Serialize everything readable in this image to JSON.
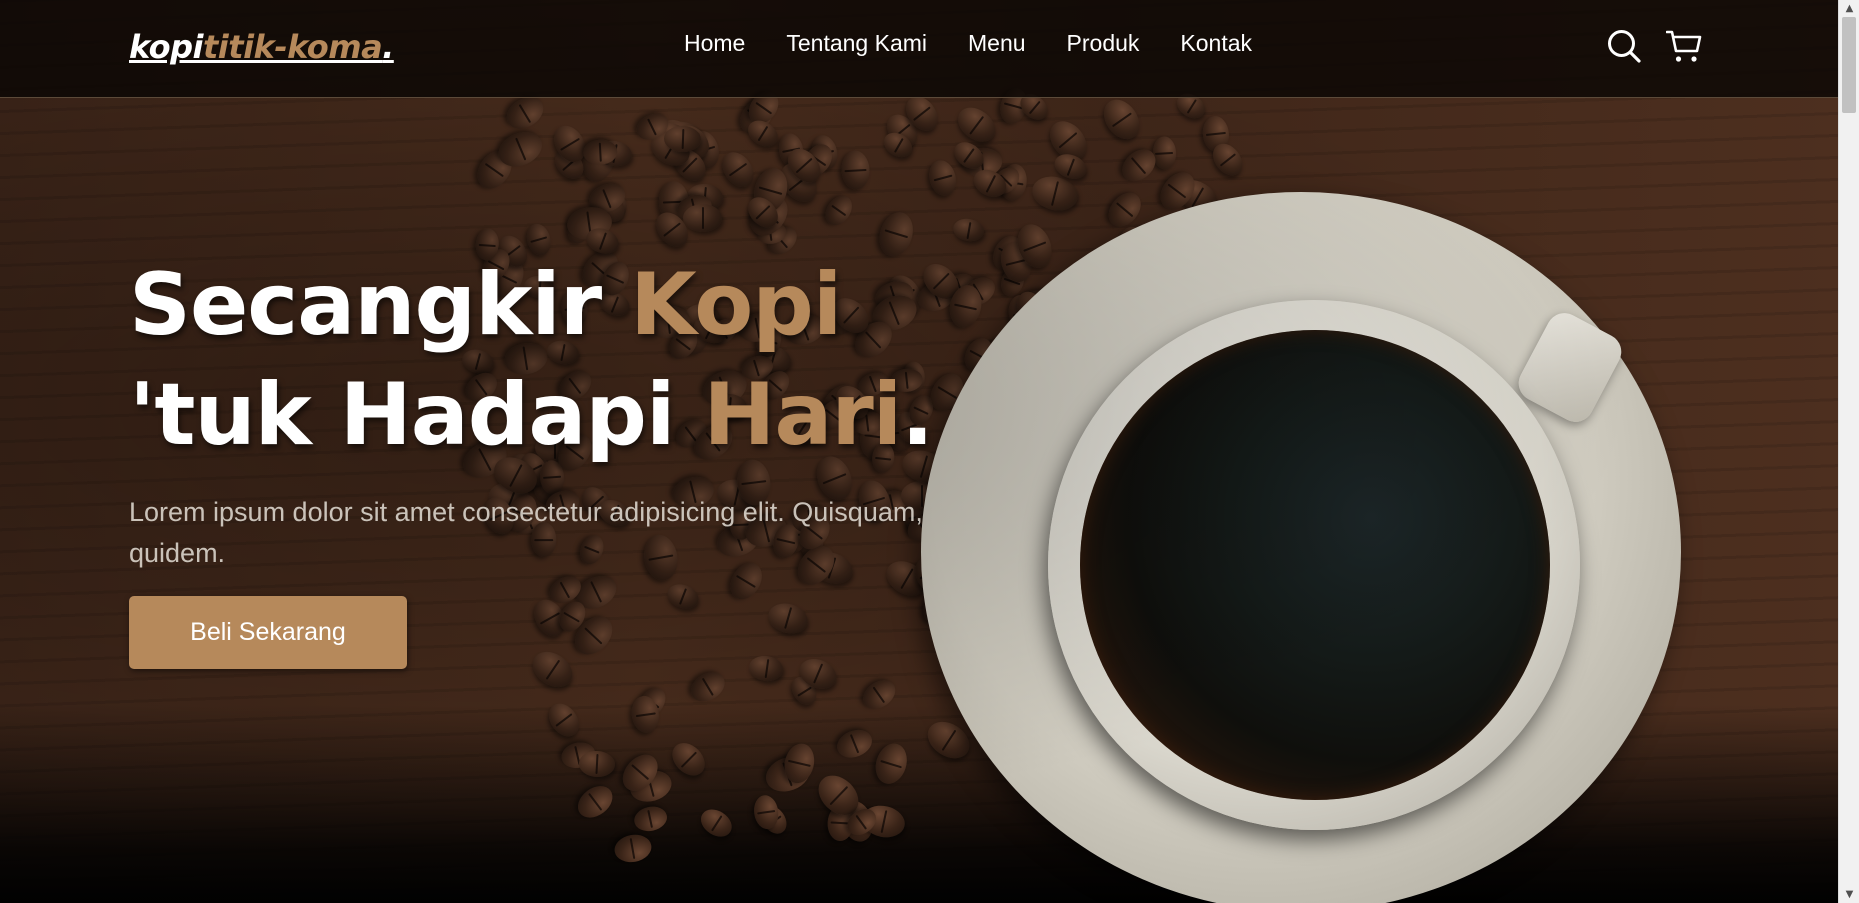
{
  "logo": {
    "part1": "kopi",
    "part2": "titik-koma",
    "part3": "."
  },
  "nav": {
    "links": [
      {
        "label": "Home"
      },
      {
        "label": "Tentang Kami"
      },
      {
        "label": "Menu"
      },
      {
        "label": "Produk"
      },
      {
        "label": "Kontak"
      }
    ],
    "icons": [
      "search-icon",
      "shopping-cart-icon"
    ]
  },
  "hero": {
    "headline": {
      "line1_a": "Secangkir ",
      "line1_b": "Kopi",
      "line2_a": "'tuk Hadapi ",
      "line2_b": "Hari",
      "line2_c": "."
    },
    "lead": "Lorem ipsum dolor sit amet consectetur adipisicing elit. Quisquam, quidem.",
    "cta_label": "Beli Sekarang"
  },
  "colors": {
    "accent": "#b6895b",
    "text": "#ffffff",
    "navbar_bg": "#0a0604"
  }
}
